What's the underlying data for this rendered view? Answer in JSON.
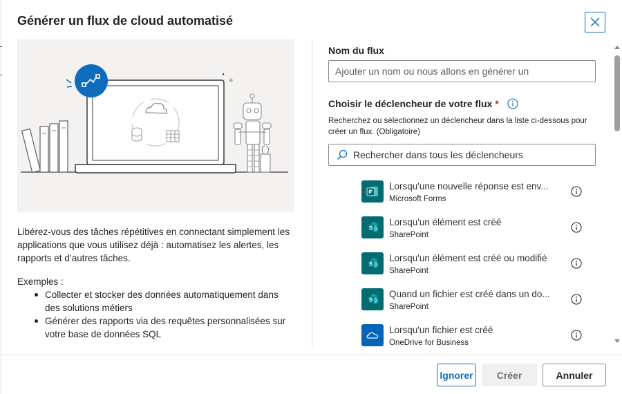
{
  "dialog": {
    "title": "Générer un flux de cloud automatisé",
    "close_label": "Fermer"
  },
  "left": {
    "description": "Libérez-vous des tâches répétitives en connectant simplement les applications que vous utilisez déjà : automatisez les alertes, les rapports et d’autres tâches.",
    "examples_label": "Exemples :",
    "examples": [
      "Collecter et stocker des données automatiquement dans des solutions métiers",
      "Générer des rapports via des requêtes personnalisées sur votre base de données SQL"
    ]
  },
  "right": {
    "flow_name_label": "Nom du flux",
    "flow_name_placeholder": "Ajouter un nom ou nous allons en générer un",
    "flow_name_value": "",
    "trigger_label": "Choisir le déclencheur de votre flux",
    "required_mark": "*",
    "helper_text": "Recherchez ou sélectionnez un déclencheur dans la liste ci-dessous pour créer un flux. (Obligatoire)",
    "search_placeholder": "Rechercher dans tous les déclencheurs",
    "triggers": [
      {
        "name": "Lorsqu'une nouvelle réponse est env...",
        "app": "Microsoft Forms",
        "icon": "forms-icon",
        "color": "#036c70"
      },
      {
        "name": "Lorsqu'un élément est créé",
        "app": "SharePoint",
        "icon": "sharepoint-icon",
        "color": "#036c70"
      },
      {
        "name": "Lorsqu'un élément est créé ou modifié",
        "app": "SharePoint",
        "icon": "sharepoint-icon",
        "color": "#036c70"
      },
      {
        "name": "Quand un fichier est créé dans un do...",
        "app": "SharePoint",
        "icon": "sharepoint-icon",
        "color": "#036c70"
      },
      {
        "name": "Lorsqu'un fichier est créé",
        "app": "OneDrive for Business",
        "icon": "onedrive-icon",
        "color": "#0364b8"
      }
    ]
  },
  "footer": {
    "skip_label": "Ignorer",
    "create_label": "Créer",
    "cancel_label": "Annuler"
  },
  "colors": {
    "accent": "#0f6cbd",
    "illustration_bg": "#f3f2f1"
  }
}
